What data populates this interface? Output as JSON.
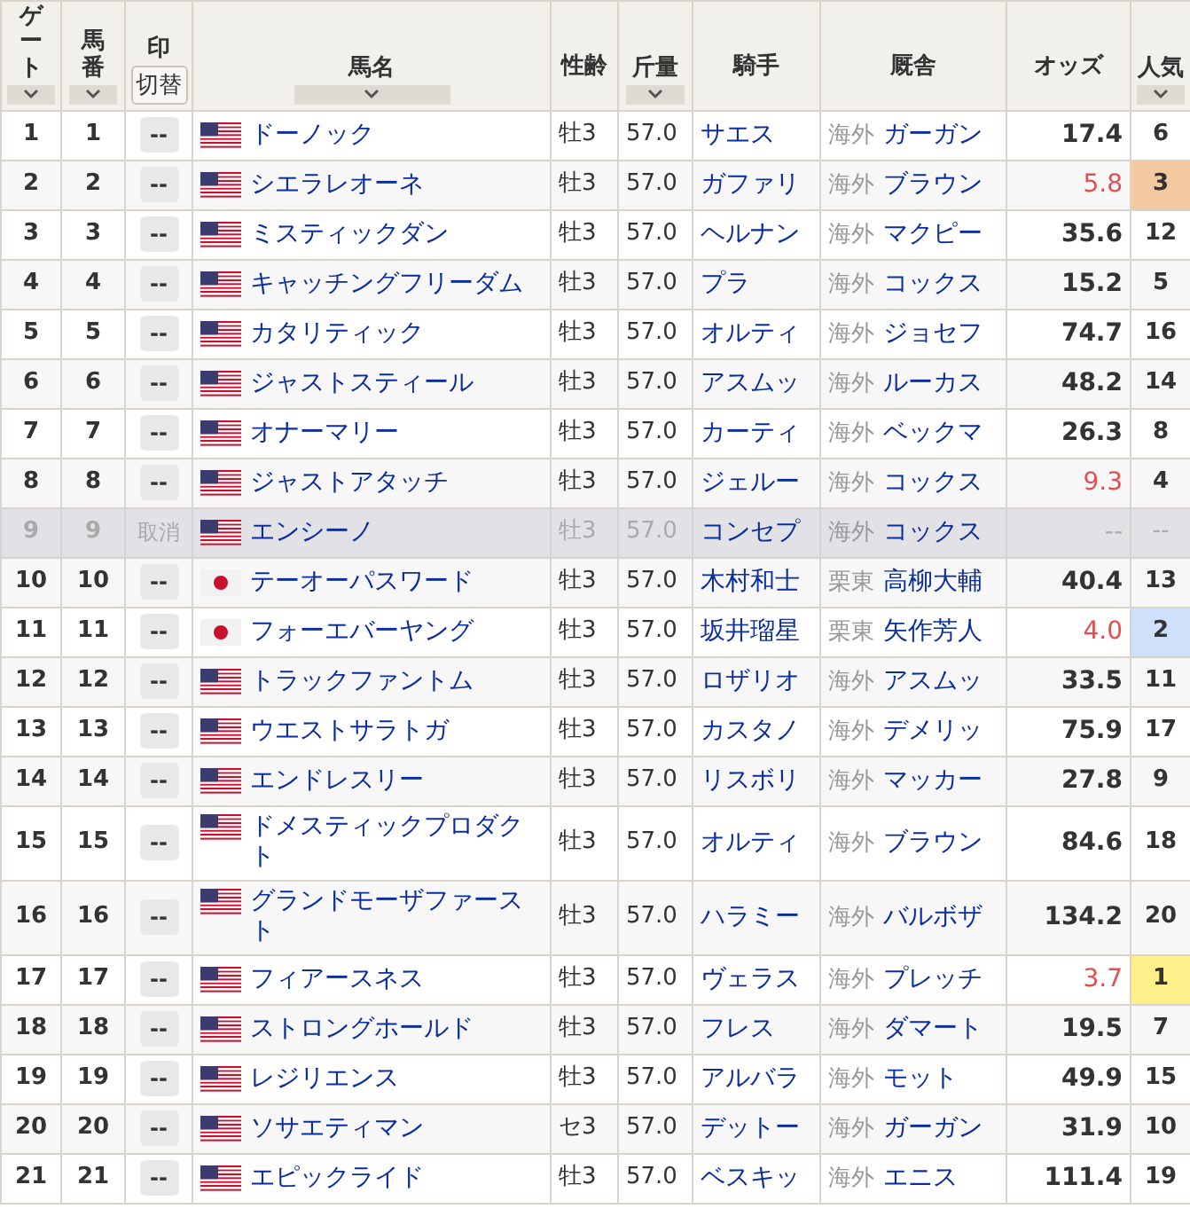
{
  "columns": [
    {
      "label": "ゲート",
      "sortable": true,
      "vertical": true
    },
    {
      "label": "馬番",
      "sortable": true,
      "vertical": true
    },
    {
      "label": "印",
      "sortable": false,
      "toggle": "切替"
    },
    {
      "label": "馬名",
      "sortable": true
    },
    {
      "label": "性齢",
      "sortable": false
    },
    {
      "label": "斤量",
      "sortable": true
    },
    {
      "label": "騎手",
      "sortable": false
    },
    {
      "label": "厩舎",
      "sortable": false
    },
    {
      "label": "オッズ",
      "sortable": false
    },
    {
      "label": "人気",
      "sortable": true
    }
  ],
  "rows": [
    {
      "gate": "1",
      "number": "1",
      "mark": "--",
      "scratched": false,
      "kind": "us",
      "name": "ドーノック",
      "sex_age": "牡3",
      "weight": "57.0",
      "jockey": "サエス",
      "region": "海外",
      "trainer": "ガーガン",
      "odds": "17.4",
      "odds_hot": false,
      "popularity": "6"
    },
    {
      "gate": "2",
      "number": "2",
      "mark": "--",
      "scratched": false,
      "kind": "us",
      "name": "シエラレオーネ",
      "sex_age": "牡3",
      "weight": "57.0",
      "jockey": "ガファリ",
      "region": "海外",
      "trainer": "ブラウン",
      "odds": "5.8",
      "odds_hot": true,
      "popularity": "3",
      "color": "#f2c9a0"
    },
    {
      "gate": "3",
      "number": "3",
      "mark": "--",
      "scratched": false,
      "kind": "us",
      "name": "ミスティックダン",
      "sex_age": "牡3",
      "weight": "57.0",
      "jockey": "ヘルナン",
      "region": "海外",
      "trainer": "マクピー",
      "odds": "35.6",
      "odds_hot": false,
      "popularity": "12"
    },
    {
      "gate": "4",
      "number": "4",
      "mark": "--",
      "scratched": false,
      "kind": "us",
      "name": "キャッチングフリーダム",
      "sex_age": "牡3",
      "weight": "57.0",
      "jockey": "プラ",
      "region": "海外",
      "trainer": "コックス",
      "odds": "15.2",
      "odds_hot": false,
      "popularity": "5"
    },
    {
      "gate": "5",
      "number": "5",
      "mark": "--",
      "scratched": false,
      "kind": "us",
      "name": "カタリティック",
      "sex_age": "牡3",
      "weight": "57.0",
      "jockey": "オルティ",
      "region": "海外",
      "trainer": "ジョセフ",
      "odds": "74.7",
      "odds_hot": false,
      "popularity": "16"
    },
    {
      "gate": "6",
      "number": "6",
      "mark": "--",
      "scratched": false,
      "kind": "us",
      "name": "ジャストスティール",
      "sex_age": "牡3",
      "weight": "57.0",
      "jockey": "アスムッ",
      "region": "海外",
      "trainer": "ルーカス",
      "odds": "48.2",
      "odds_hot": false,
      "popularity": "14"
    },
    {
      "gate": "7",
      "number": "7",
      "mark": "--",
      "scratched": false,
      "kind": "us",
      "name": "オナーマリー",
      "sex_age": "牡3",
      "weight": "57.0",
      "jockey": "カーティ",
      "region": "海外",
      "trainer": "ベックマ",
      "odds": "26.3",
      "odds_hot": false,
      "popularity": "8"
    },
    {
      "gate": "8",
      "number": "8",
      "mark": "--",
      "scratched": false,
      "kind": "us",
      "name": "ジャストアタッチ",
      "sex_age": "牡3",
      "weight": "57.0",
      "jockey": "ジェルー",
      "region": "海外",
      "trainer": "コックス",
      "odds": "9.3",
      "odds_hot": true,
      "popularity": "4"
    },
    {
      "gate": "9",
      "number": "9",
      "mark": "取消",
      "scratched": true,
      "kind": "us",
      "name": "エンシーノ",
      "sex_age": "牡3",
      "weight": "57.0",
      "jockey": "コンセプ",
      "region": "海外",
      "trainer": "コックス",
      "odds": "--",
      "odds_hot": false,
      "popularity": "--"
    },
    {
      "gate": "10",
      "number": "10",
      "mark": "--",
      "scratched": false,
      "kind": "jp",
      "name": "テーオーパスワード",
      "sex_age": "牡3",
      "weight": "57.0",
      "jockey": "木村和士",
      "region": "栗東",
      "trainer": "高柳大輔",
      "odds": "40.4",
      "odds_hot": false,
      "popularity": "13"
    },
    {
      "gate": "11",
      "number": "11",
      "mark": "--",
      "scratched": false,
      "kind": "jp",
      "name": "フォーエバーヤング",
      "sex_age": "牡3",
      "weight": "57.0",
      "jockey": "坂井瑠星",
      "region": "栗東",
      "trainer": "矢作芳人",
      "odds": "4.0",
      "odds_hot": true,
      "popularity": "2",
      "color": "#cfe0fb"
    },
    {
      "gate": "12",
      "number": "12",
      "mark": "--",
      "scratched": false,
      "kind": "us",
      "name": "トラックファントム",
      "sex_age": "牡3",
      "weight": "57.0",
      "jockey": "ロザリオ",
      "region": "海外",
      "trainer": "アスムッ",
      "odds": "33.5",
      "odds_hot": false,
      "popularity": "11"
    },
    {
      "gate": "13",
      "number": "13",
      "mark": "--",
      "scratched": false,
      "kind": "us",
      "name": "ウエストサラトガ",
      "sex_age": "牡3",
      "weight": "57.0",
      "jockey": "カスタノ",
      "region": "海外",
      "trainer": "デメリッ",
      "odds": "75.9",
      "odds_hot": false,
      "popularity": "17"
    },
    {
      "gate": "14",
      "number": "14",
      "mark": "--",
      "scratched": false,
      "kind": "us",
      "name": "エンドレスリー",
      "sex_age": "牡3",
      "weight": "57.0",
      "jockey": "リスボリ",
      "region": "海外",
      "trainer": "マッカー",
      "odds": "27.8",
      "odds_hot": false,
      "popularity": "9"
    },
    {
      "gate": "15",
      "number": "15",
      "mark": "--",
      "scratched": false,
      "kind": "us",
      "name": "ドメスティックプロダクト",
      "sex_age": "牡3",
      "weight": "57.0",
      "jockey": "オルティ",
      "region": "海外",
      "trainer": "ブラウン",
      "odds": "84.6",
      "odds_hot": false,
      "popularity": "18"
    },
    {
      "gate": "16",
      "number": "16",
      "mark": "--",
      "scratched": false,
      "kind": "us",
      "name": "グランドモーザファースト",
      "sex_age": "牡3",
      "weight": "57.0",
      "jockey": "ハラミー",
      "region": "海外",
      "trainer": "バルボザ",
      "odds": "134.2",
      "odds_hot": false,
      "popularity": "20"
    },
    {
      "gate": "17",
      "number": "17",
      "mark": "--",
      "scratched": false,
      "kind": "us",
      "name": "フィアースネス",
      "sex_age": "牡3",
      "weight": "57.0",
      "jockey": "ヴェラス",
      "region": "海外",
      "trainer": "プレッチ",
      "odds": "3.7",
      "odds_hot": true,
      "popularity": "1",
      "color": "#fdf08a"
    },
    {
      "gate": "18",
      "number": "18",
      "mark": "--",
      "scratched": false,
      "kind": "us",
      "name": "ストロングホールド",
      "sex_age": "牡3",
      "weight": "57.0",
      "jockey": "フレス",
      "region": "海外",
      "trainer": "ダマート",
      "odds": "19.5",
      "odds_hot": false,
      "popularity": "7"
    },
    {
      "gate": "19",
      "number": "19",
      "mark": "--",
      "scratched": false,
      "kind": "us",
      "name": "レジリエンス",
      "sex_age": "牡3",
      "weight": "57.0",
      "jockey": "アルバラ",
      "region": "海外",
      "trainer": "モット",
      "odds": "49.9",
      "odds_hot": false,
      "popularity": "15"
    },
    {
      "gate": "20",
      "number": "20",
      "mark": "--",
      "scratched": false,
      "kind": "us",
      "name": "ソサエティマン",
      "sex_age": "セ3",
      "weight": "57.0",
      "jockey": "デットー",
      "region": "海外",
      "trainer": "ガーガン",
      "odds": "31.9",
      "odds_hot": false,
      "popularity": "10"
    },
    {
      "gate": "21",
      "number": "21",
      "mark": "--",
      "scratched": false,
      "kind": "us",
      "name": "エピックライド",
      "sex_age": "牡3",
      "weight": "57.0",
      "jockey": "ベスキッ",
      "region": "海外",
      "trainer": "エニス",
      "odds": "111.4",
      "odds_hot": false,
      "popularity": "19"
    }
  ]
}
